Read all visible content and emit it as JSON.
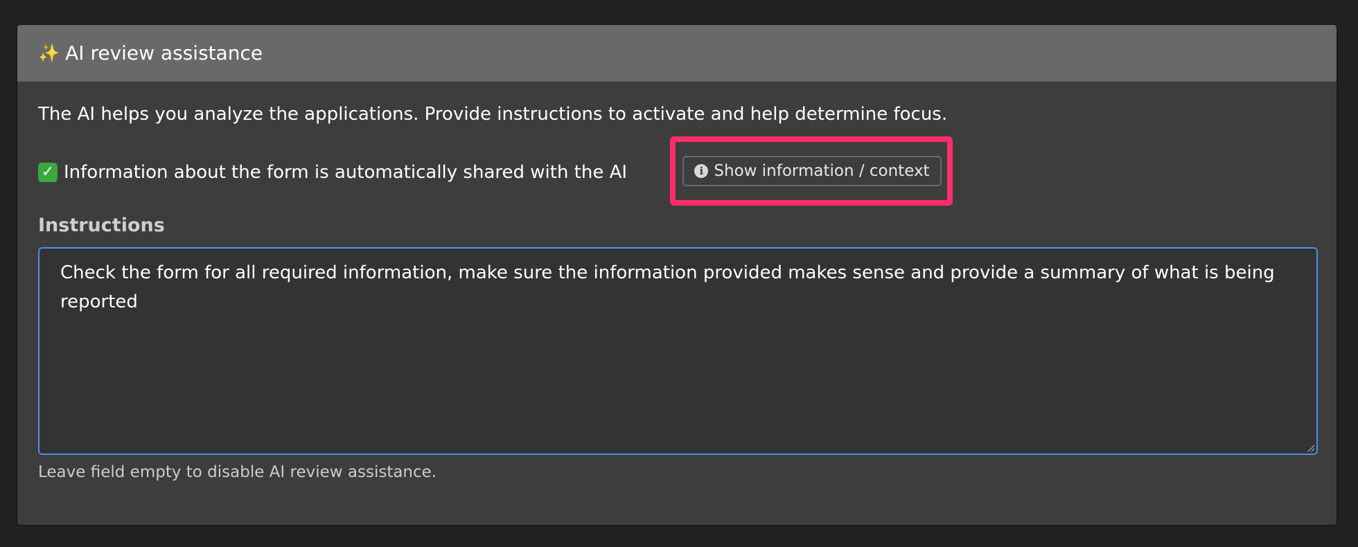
{
  "panel": {
    "title": "AI review assistance",
    "title_icon": "sparkles-icon"
  },
  "intro_text": "The AI helps you analyze the applications. Provide instructions to activate and help determine focus.",
  "shared_notice": {
    "icon": "check-mark-icon",
    "text": "Information about the form is automatically shared with the AI"
  },
  "info_button": {
    "icon": "info-circle-icon",
    "label": "Show information / context"
  },
  "instructions": {
    "label": "Instructions",
    "value": "Check the form for all required information, make sure the information provided makes sense and provide a summary of what is being reported",
    "help": "Leave field empty to disable AI review assistance."
  },
  "colors": {
    "highlight": "#ff2d6a",
    "focus_border": "#4a8fe8",
    "check_green": "#3aa83a"
  }
}
